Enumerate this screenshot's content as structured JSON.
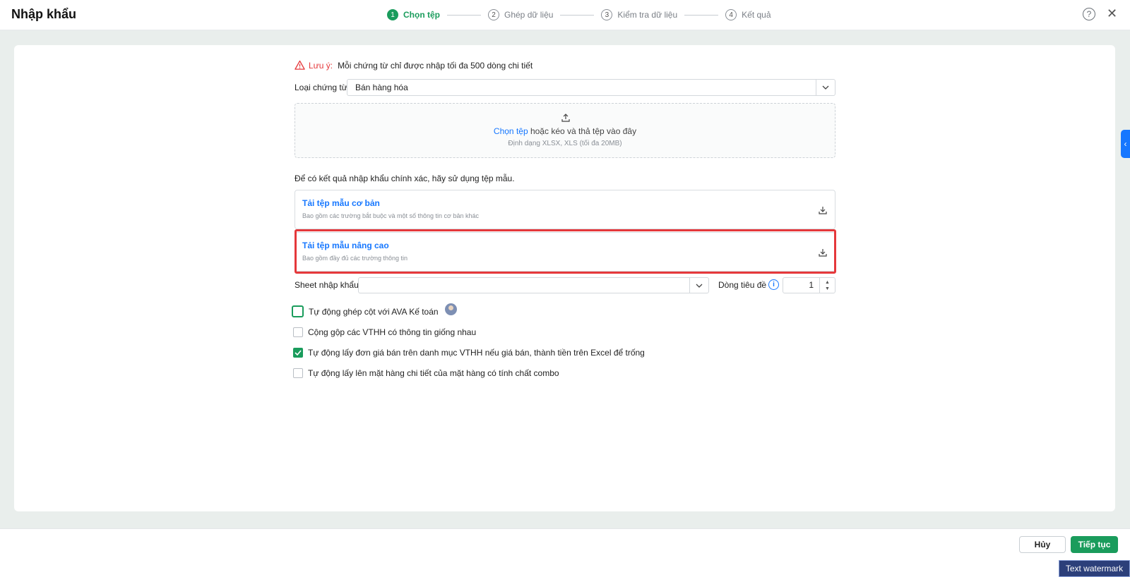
{
  "header": {
    "title": "Nhập khẩu",
    "steps": [
      {
        "num": "1",
        "label": "Chọn tệp"
      },
      {
        "num": "2",
        "label": "Ghép dữ liệu"
      },
      {
        "num": "3",
        "label": "Kiểm tra dữ liệu"
      },
      {
        "num": "4",
        "label": "Kết quả"
      }
    ],
    "active_step": 1,
    "help_icon": "?",
    "close_icon": "✕"
  },
  "note": {
    "label": "Lưu ý:",
    "text": "Mỗi chứng từ chỉ được nhập tối đa 500 dòng chi tiết"
  },
  "voucher_type": {
    "label": "Loại chứng từ",
    "value": "Bán hàng hóa"
  },
  "dropzone": {
    "link": "Chọn tệp",
    "text": " hoặc kéo và thả tệp vào đây",
    "format": "Định dạng XLSX, XLS (tối đa 20MB)"
  },
  "hint": "Để có kết quả nhập khẩu chính xác, hãy sử dụng tệp mẫu.",
  "templates": [
    {
      "title": "Tải tệp mẫu cơ bản",
      "desc": "Bao gồm các trường bắt buộc và một số thông tin cơ bản khác"
    },
    {
      "title": "Tải tệp mẫu nâng cao",
      "desc": "Bao gồm đầy đủ các trường thông tin"
    }
  ],
  "sheet": {
    "label": "Sheet nhập khẩu",
    "value": ""
  },
  "header_row": {
    "label": "Dòng tiêu đề",
    "value": "1",
    "info_icon": "i"
  },
  "options": [
    {
      "label": "Tự động ghép cột với AVA Kế toán",
      "checked": false
    },
    {
      "label": "Cộng gộp các VTHH có thông tin giống nhau",
      "checked": false
    },
    {
      "label": "Tự động lấy đơn giá bán trên danh mục VTHH nếu giá bán, thành tiền trên Excel để trống",
      "checked": true
    },
    {
      "label": "Tự động lấy lên mặt hàng chi tiết của mặt hàng có tính chất combo",
      "checked": false
    }
  ],
  "footer": {
    "cancel": "Hủy",
    "next": "Tiếp tục"
  },
  "side_tab_icon": "‹",
  "watermark": "Text watermark",
  "colors": {
    "primary_green": "#1a9c5c",
    "link_blue": "#1677ff",
    "warning_red": "#e5383b"
  }
}
